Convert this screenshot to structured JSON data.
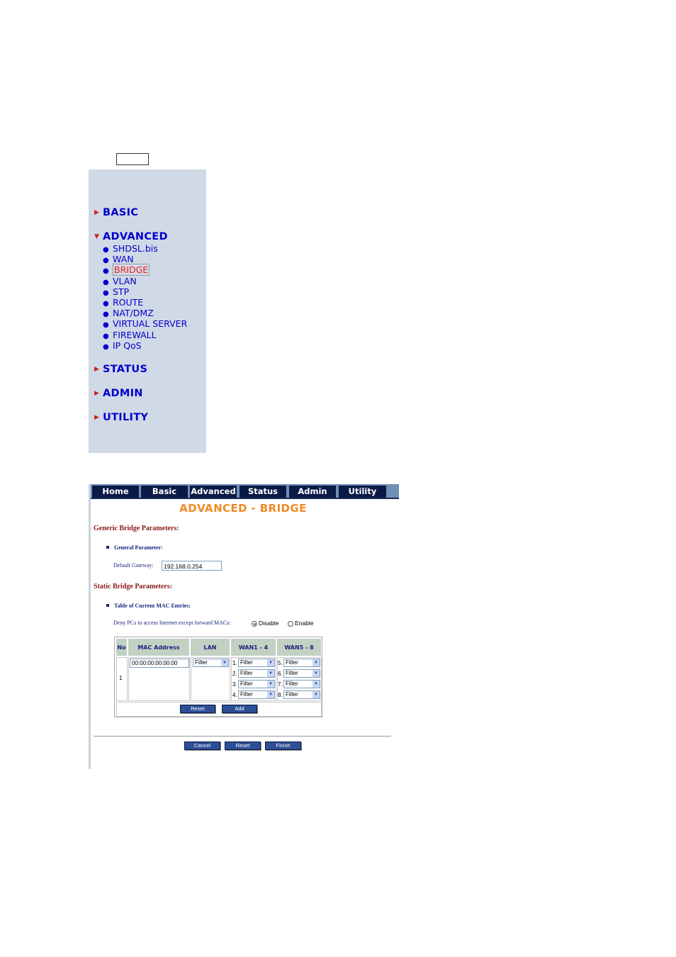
{
  "sidebar": {
    "sections": [
      {
        "label": "BASIC"
      },
      {
        "label": "ADVANCED"
      },
      {
        "label": "STATUS"
      },
      {
        "label": "ADMIN"
      },
      {
        "label": "UTILITY"
      }
    ],
    "advanced_items": [
      {
        "label": "SHDSL.bis"
      },
      {
        "label": "WAN"
      },
      {
        "label": "BRIDGE",
        "active": true
      },
      {
        "label": "VLAN"
      },
      {
        "label": "STP"
      },
      {
        "label": "ROUTE"
      },
      {
        "label": "NAT/DMZ"
      },
      {
        "label": "VIRTUAL SERVER"
      },
      {
        "label": "FIREWALL"
      },
      {
        "label": "IP QoS"
      }
    ]
  },
  "nav": {
    "tabs": [
      {
        "label": "Home"
      },
      {
        "label": "Basic"
      },
      {
        "label": "Advanced"
      },
      {
        "label": "Status"
      },
      {
        "label": "Admin"
      },
      {
        "label": "Utility"
      }
    ]
  },
  "page": {
    "title": "ADVANCED - BRIDGE",
    "generic_heading": "Generic Bridge Parameters:",
    "general_param_heading": "General Parameter:",
    "default_gateway_label": "Default Gateway:",
    "default_gateway_value": "192.168.0.254",
    "static_heading": "Static Bridge Parameters:",
    "mac_table_heading": "Table of Current MAC Entries:",
    "deny_label": "Deny PCs to access Internet except forward MACs:",
    "radio_disable": "Disable",
    "radio_enable": "Enable",
    "radio_selected": "Disable"
  },
  "table": {
    "headers": {
      "no": "No",
      "mac": "MAC Address",
      "lan": "LAN",
      "wan1": "WAN1 - 4",
      "wan5": "WAN5 - 8"
    },
    "row_no": "1",
    "mac_value": "00:00:00:00:00:00",
    "lan_value": "Filter",
    "wan_left": [
      {
        "n": "1.",
        "v": "Filter"
      },
      {
        "n": "2.",
        "v": "Filter"
      },
      {
        "n": "3.",
        "v": "Filter"
      },
      {
        "n": "4.",
        "v": "Filter"
      }
    ],
    "wan_right": [
      {
        "n": "5.",
        "v": "Filter"
      },
      {
        "n": "6.",
        "v": "Filter"
      },
      {
        "n": "7.",
        "v": "Filter"
      },
      {
        "n": "8.",
        "v": "Filter"
      }
    ],
    "reset_label": "Reset",
    "add_label": "Add"
  },
  "footer": {
    "cancel_label": "Cancel",
    "reset_label": "Reset",
    "finish_label": "Finish"
  },
  "colors": {
    "sidebar_bg": "#d0d9e6",
    "nav_tab_bg": "#0b1947",
    "title_orange": "#f08a24",
    "heading_red": "#8b1a1a",
    "link_blue": "#0000cc"
  }
}
